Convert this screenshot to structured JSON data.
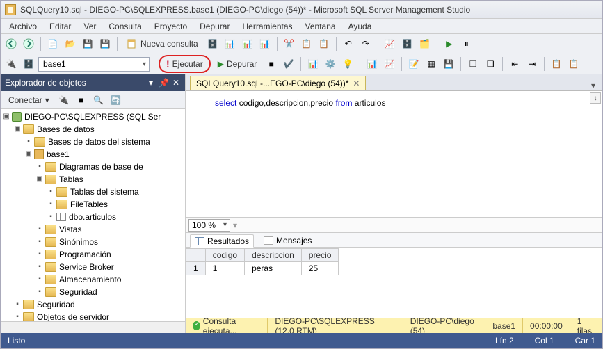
{
  "title": "SQLQuery10.sql - DIEGO-PC\\SQLEXPRESS.base1 (DIEGO-PC\\diego (54))* - Microsoft SQL Server Management Studio",
  "menu": {
    "archivo": "Archivo",
    "editar": "Editar",
    "ver": "Ver",
    "consulta": "Consulta",
    "proyecto": "Proyecto",
    "depurar": "Depurar",
    "herramientas": "Herramientas",
    "ventana": "Ventana",
    "ayuda": "Ayuda"
  },
  "toolbar1": {
    "nueva_consulta": "Nueva consulta"
  },
  "toolbar2": {
    "db": "base1",
    "ejecutar": "Ejecutar",
    "depurar": "Depurar"
  },
  "explorer": {
    "title": "Explorador de objetos",
    "conectar": "Conectar",
    "tree": {
      "server": "DIEGO-PC\\SQLEXPRESS (SQL Ser",
      "bases": "Bases de datos",
      "sysdb": "Bases de datos del sistema",
      "base1": "base1",
      "diagramas": "Diagramas de base de",
      "tablas": "Tablas",
      "systables": "Tablas del sistema",
      "filetables": "FileTables",
      "dbo_articulos": "dbo.articulos",
      "vistas": "Vistas",
      "sinonimos": "Sinónimos",
      "programacion": "Programación",
      "servicebroker": "Service Broker",
      "almacenamiento": "Almacenamiento",
      "seguridad_db": "Seguridad",
      "seguridad": "Seguridad",
      "objetos_serv": "Objetos de servidor"
    }
  },
  "tab": {
    "label": "SQLQuery10.sql -...EGO-PC\\diego (54))*"
  },
  "sql": {
    "pre": "select",
    "mid1": " codigo,descripcion,precio ",
    "from": "from",
    "post": " articulos"
  },
  "zoom": "100 %",
  "results_tabs": {
    "resultados": "Resultados",
    "mensajes": "Mensajes"
  },
  "grid": {
    "headers": {
      "codigo": "codigo",
      "descripcion": "descripcion",
      "precio": "precio"
    },
    "rows": [
      {
        "n": "1",
        "codigo": "1",
        "descripcion": "peras",
        "precio": "25"
      }
    ]
  },
  "strip": {
    "status": "Consulta ejecuta...",
    "server": "DIEGO-PC\\SQLEXPRESS (12.0 RTM)",
    "user": "DIEGO-PC\\diego (54)",
    "db": "base1",
    "time": "00:00:00",
    "rows": "1 filas"
  },
  "appstatus": {
    "listo": "Listo",
    "lin": "Lín 2",
    "col": "Col 1",
    "car": "Car 1"
  }
}
